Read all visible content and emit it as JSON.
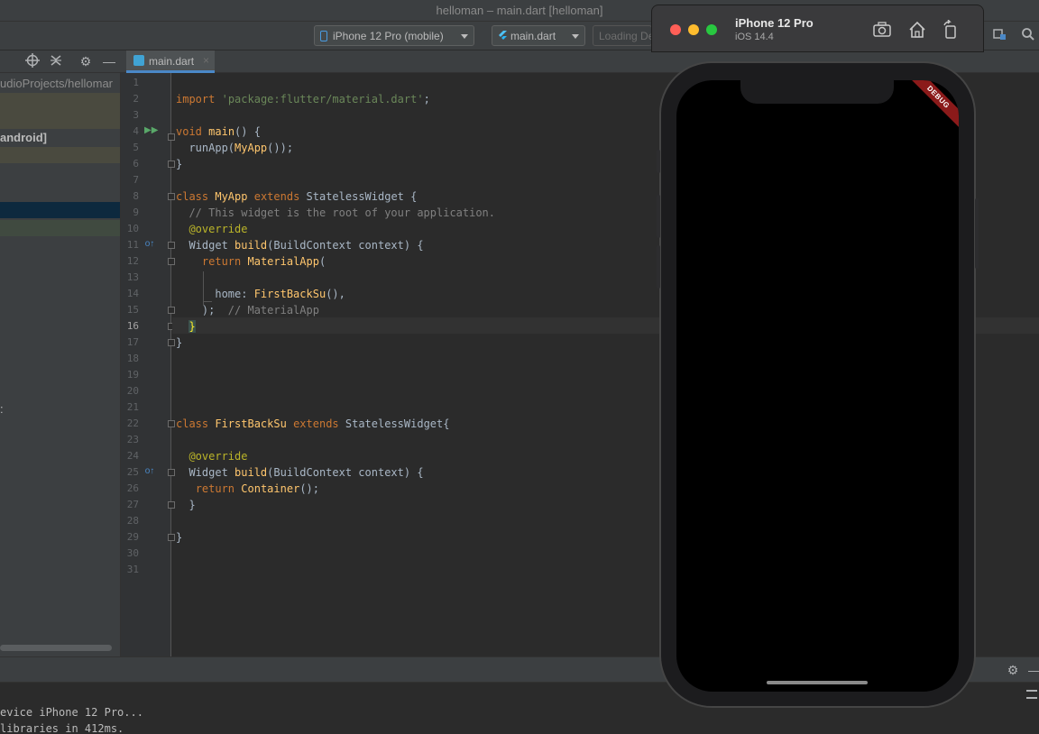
{
  "window": {
    "title": "helloman – main.dart [helloman]"
  },
  "toolbar": {
    "device_select": "iPhone 12 Pro (mobile)",
    "config_select": "main.dart",
    "loading_text": "Loading De"
  },
  "project": {
    "path_text": "udioProjects/hellomar",
    "android_label": "android]",
    "stray_mark": ":"
  },
  "editor": {
    "tab_label": "main.dart",
    "tab_close": "×",
    "current_line": 16,
    "lines": [
      {
        "n": "1",
        "code": ""
      },
      {
        "n": "2",
        "code": "import 'package:flutter/material.dart';"
      },
      {
        "n": "3",
        "code": ""
      },
      {
        "n": "4",
        "code": "void main() {"
      },
      {
        "n": "5",
        "code": "  runApp(MyApp());"
      },
      {
        "n": "6",
        "code": "}"
      },
      {
        "n": "7",
        "code": ""
      },
      {
        "n": "8",
        "code": "class MyApp extends StatelessWidget {"
      },
      {
        "n": "9",
        "code": "  // This widget is the root of your application."
      },
      {
        "n": "10",
        "code": "  @override"
      },
      {
        "n": "11",
        "code": "  Widget build(BuildContext context) {"
      },
      {
        "n": "12",
        "code": "    return MaterialApp("
      },
      {
        "n": "13",
        "code": ""
      },
      {
        "n": "14",
        "code": "      home: FirstBackSu(),"
      },
      {
        "n": "15",
        "code": "    );  // MaterialApp"
      },
      {
        "n": "16",
        "code": "  }"
      },
      {
        "n": "17",
        "code": "}"
      },
      {
        "n": "18",
        "code": ""
      },
      {
        "n": "19",
        "code": ""
      },
      {
        "n": "20",
        "code": ""
      },
      {
        "n": "21",
        "code": ""
      },
      {
        "n": "22",
        "code": "class FirstBackSu extends StatelessWidget{"
      },
      {
        "n": "23",
        "code": ""
      },
      {
        "n": "24",
        "code": "  @override"
      },
      {
        "n": "25",
        "code": "  Widget build(BuildContext context) {"
      },
      {
        "n": "26",
        "code": "   return Container();"
      },
      {
        "n": "27",
        "code": "  }"
      },
      {
        "n": "28",
        "code": ""
      },
      {
        "n": "29",
        "code": "}"
      },
      {
        "n": "30",
        "code": ""
      },
      {
        "n": "31",
        "code": ""
      }
    ]
  },
  "console": {
    "lines": [
      "evice iPhone 12 Pro...",
      "libraries in 412ms."
    ]
  },
  "simulator": {
    "device_name": "iPhone 12 Pro",
    "os_version": "iOS 14.4",
    "debug_banner": "DEBUG",
    "buttons": [
      "screenshot-icon",
      "home-icon",
      "rotate-icon"
    ]
  },
  "colors": {
    "keyword": "#cc7832",
    "string": "#6a8759",
    "function": "#ffc66d",
    "comment": "#808080",
    "annotation": "#bbb529",
    "debug_banner": "#8b1a1a"
  }
}
